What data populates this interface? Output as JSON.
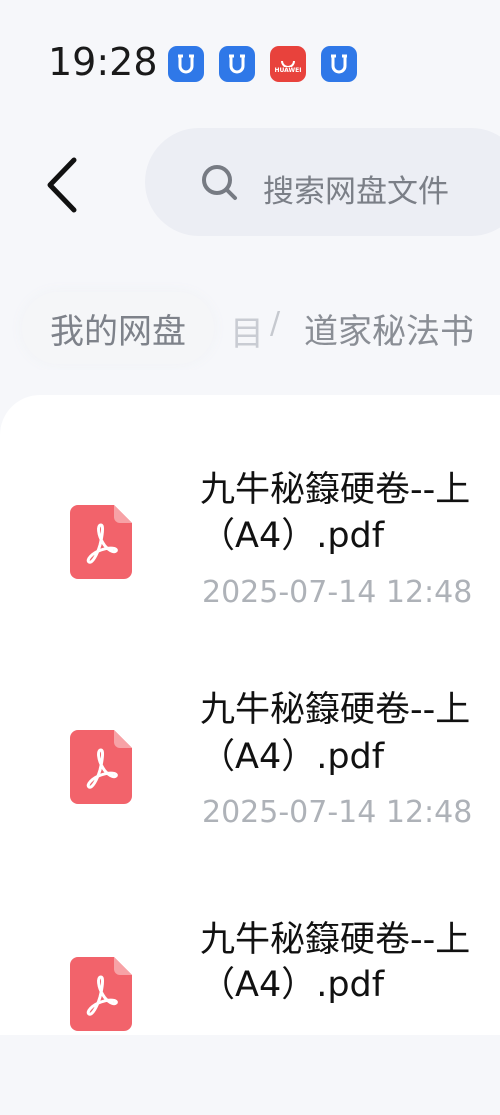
{
  "status_bar": {
    "time": "19:28",
    "notification_icons": [
      "app-icon",
      "app-icon",
      "huawei-appgallery-icon",
      "app-icon"
    ],
    "huawei_label": "HUAWEI"
  },
  "header": {
    "search_placeholder": "搜索网盘文件"
  },
  "breadcrumb": {
    "home": "我的网盘",
    "hidden_fragment": "目",
    "separator": "/",
    "current": "道家秘法书"
  },
  "files": [
    {
      "name_line1": "九牛秘籙硬卷--上",
      "name_line2": "（A4）.pdf",
      "date": "2025-07-14  12:48"
    },
    {
      "name_line1": "九牛秘籙硬卷--上",
      "name_line2": "（A4）.pdf",
      "date": "2025-07-14  12:48"
    },
    {
      "name_line1": "九牛秘籙硬卷--上",
      "name_line2": "（A4）.pdf",
      "date": ""
    }
  ],
  "colors": {
    "accent_blue": "#2f78e8",
    "pdf_red": "#f2636b",
    "huawei_red": "#e8423c"
  }
}
